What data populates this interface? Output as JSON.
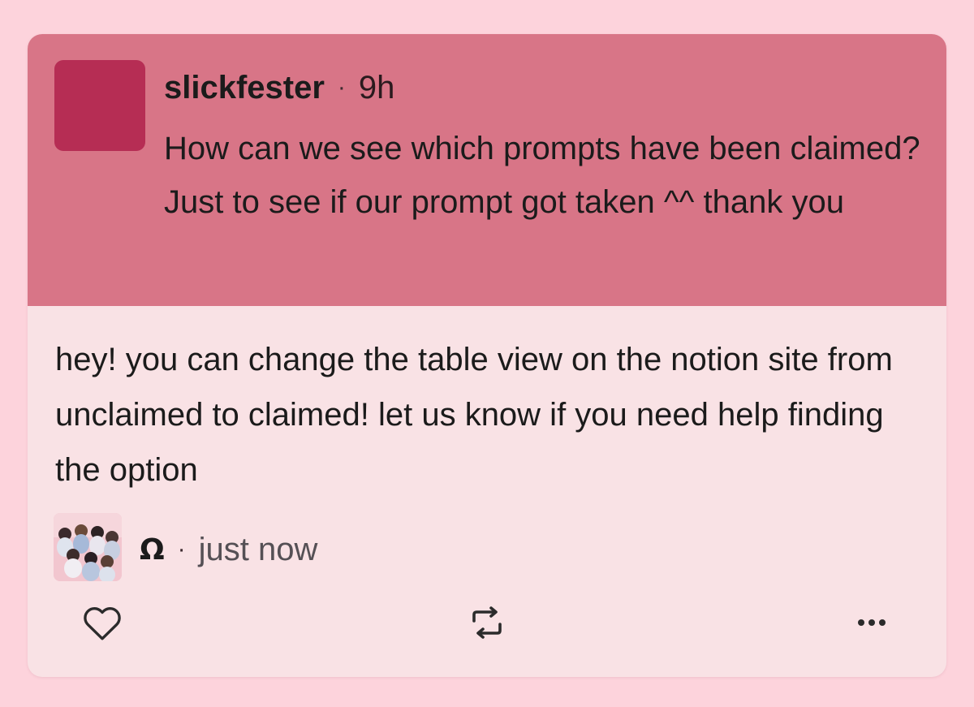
{
  "question": {
    "username": "slickfester",
    "separator": "·",
    "time": "9h",
    "text": "How can we see which prompts have been claimed? Just to see if our prompt got taken ^^ thank you"
  },
  "answer": {
    "text": "hey! you can change the table view on the notion site from unclaimed to claimed! let us know if you need help finding the option",
    "author_name": "Ω",
    "separator": "·",
    "time": "just now"
  },
  "actions": {
    "icons": [
      "heart-icon",
      "repost-icon",
      "more-icon"
    ]
  },
  "colors": {
    "background": "#fdd3dc",
    "question_bg": "#d87587",
    "question_avatar": "#b62d54",
    "card_bg": "#f9e2e5"
  }
}
